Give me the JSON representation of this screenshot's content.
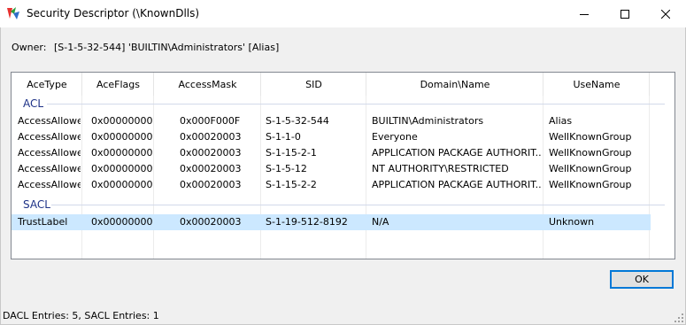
{
  "window": {
    "title": "Security Descriptor (\\KnownDlls)"
  },
  "owner": {
    "label": "Owner:",
    "value": "[S-1-5-32-544] 'BUILTIN\\Administrators' [Alias]"
  },
  "columns": [
    "AceType",
    "AceFlags",
    "AccessMask",
    "SID",
    "Domain\\Name",
    "UseName"
  ],
  "groups": [
    {
      "label": "ACL",
      "rows": [
        [
          "AccessAllowed",
          "0x00000000",
          "0x000F000F",
          "S-1-5-32-544",
          "BUILTIN\\Administrators",
          "Alias"
        ],
        [
          "AccessAllowed",
          "0x00000000",
          "0x00020003",
          "S-1-1-0",
          "Everyone",
          "WellKnownGroup"
        ],
        [
          "AccessAllowed",
          "0x00000000",
          "0x00020003",
          "S-1-15-2-1",
          "APPLICATION PACKAGE AUTHORIT...",
          "WellKnownGroup"
        ],
        [
          "AccessAllowed",
          "0x00000000",
          "0x00020003",
          "S-1-5-12",
          "NT AUTHORITY\\RESTRICTED",
          "WellKnownGroup"
        ],
        [
          "AccessAllowed",
          "0x00000000",
          "0x00020003",
          "S-1-15-2-2",
          "APPLICATION PACKAGE AUTHORIT...",
          "WellKnownGroup"
        ]
      ]
    },
    {
      "label": "SACL",
      "rows": [
        [
          "TrustLabel",
          "0x00000000",
          "0x00020003",
          "S-1-19-512-8192",
          "N/A",
          "Unknown"
        ]
      ]
    }
  ],
  "buttons": {
    "ok": "OK"
  },
  "status": "DACL Entries: 5, SACL Entries: 1",
  "colors": {
    "selection": "#cce8ff",
    "group_text": "#1e3287",
    "button_focus": "#0078d7"
  },
  "icons": {
    "app": "security-app-icon",
    "minimize": "minimize-icon",
    "maximize": "maximize-icon",
    "close": "close-icon"
  }
}
